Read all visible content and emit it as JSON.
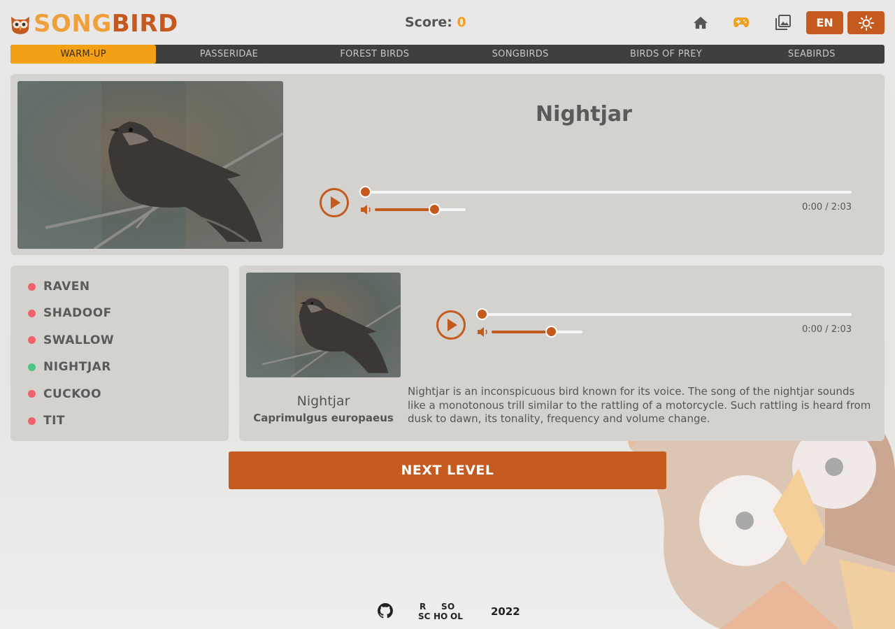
{
  "header": {
    "logo": {
      "part1": "SONG",
      "part2": "BIRD"
    },
    "score_label": "Score:",
    "score_value": "0",
    "icons": [
      "home-icon",
      "gamepad-icon",
      "gallery-icon",
      "sun-icon"
    ],
    "lang_label": "EN"
  },
  "nav": {
    "tabs": [
      {
        "label": "WARM-UP",
        "active": true
      },
      {
        "label": "PASSERIDAE",
        "active": false
      },
      {
        "label": "FOREST BIRDS",
        "active": false
      },
      {
        "label": "SONGBIRDS",
        "active": false
      },
      {
        "label": "BIRDS OF PREY",
        "active": false
      },
      {
        "label": "SEABIRDS",
        "active": false
      }
    ]
  },
  "question": {
    "title": "Nightjar",
    "player": {
      "time": "0:00 / 2:03",
      "progress": 0,
      "volume": 0.75
    }
  },
  "options": [
    {
      "label": "RAVEN",
      "status": "wrong"
    },
    {
      "label": "SHADOOF",
      "status": "wrong"
    },
    {
      "label": "SWALLOW",
      "status": "wrong"
    },
    {
      "label": "NIGHTJAR",
      "status": "correct"
    },
    {
      "label": "CUCKOO",
      "status": "wrong"
    },
    {
      "label": "TIT",
      "status": "wrong"
    }
  ],
  "info": {
    "name": "Nightjar",
    "latin": "Caprimulgus europaeus",
    "description": "Nightjar is an inconspicuous bird known for its voice. The song of the nightjar sounds like a monotonous trill similar to the rattling of a motorcycle. Such rattling is heard from dusk to dawn, its tonality, frequency and volume change.",
    "player": {
      "time": "0:00 / 2:03",
      "progress": 0,
      "volume": 0.75
    }
  },
  "next_button": "NEXT LEVEL",
  "footer": {
    "year": "2022",
    "rs_school_logo": "RS SCHOOL"
  },
  "colors": {
    "accent": "#c45a1e",
    "logo_light": "#f0a03a",
    "active_tab": "#f2a014",
    "correct": "#4fc57f",
    "wrong": "#f0626a"
  }
}
